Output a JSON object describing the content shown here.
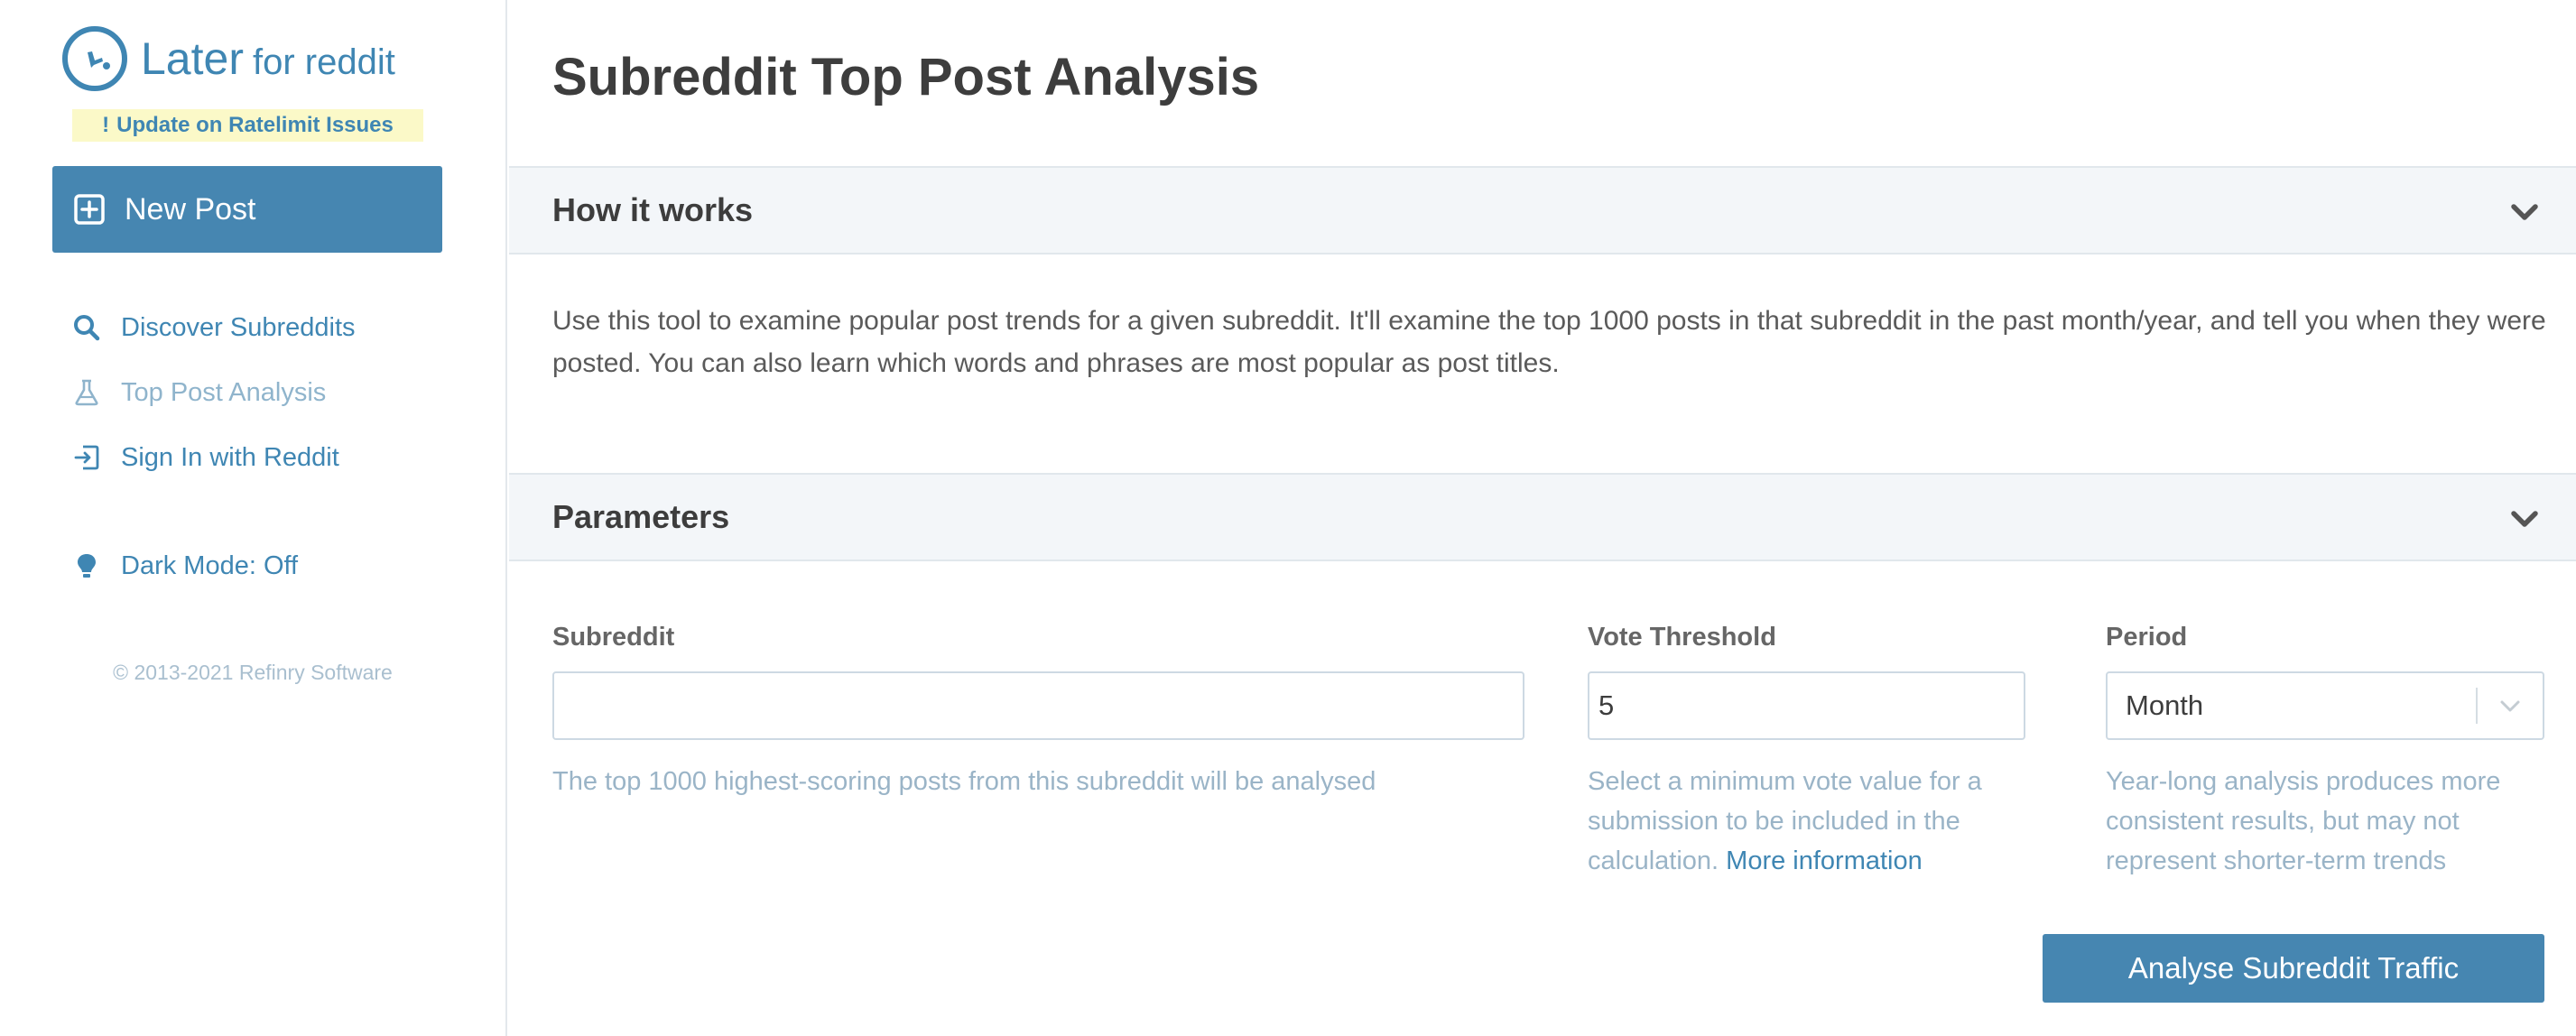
{
  "sidebar": {
    "logo": {
      "main": "Later",
      "sub": "for reddit"
    },
    "notice": "Update on Ratelimit Issues",
    "new_post": "New Post",
    "nav": [
      {
        "label": "Discover Subreddits",
        "icon": "search-icon"
      },
      {
        "label": "Top Post Analysis",
        "icon": "flask-icon",
        "active": true
      },
      {
        "label": "Sign In with Reddit",
        "icon": "sign-in-icon"
      }
    ],
    "dark_mode": "Dark Mode: Off",
    "copyright": "© 2013-2021 Refinry Software"
  },
  "main": {
    "title": "Subreddit Top Post Analysis",
    "how_it_works": {
      "heading": "How it works",
      "text": "Use this tool to examine popular post trends for a given subreddit. It'll examine the top 1000 posts in that subreddit in the past month/year, and tell you when they were posted. You can also learn which words and phrases are most popular as post titles."
    },
    "parameters": {
      "heading": "Parameters",
      "subreddit": {
        "label": "Subreddit",
        "value": "",
        "help": "The top 1000 highest-scoring posts from this subreddit will be analysed"
      },
      "vote_threshold": {
        "label": "Vote Threshold",
        "value": "5",
        "help": "Select a minimum vote value for a submission to be included in the calculation.",
        "help_link": "More information"
      },
      "period": {
        "label": "Period",
        "value": "Month",
        "help": "Year-long analysis produces more consistent results, but may not represent shorter-term trends"
      },
      "submit": "Analyse Subreddit Traffic"
    }
  },
  "colors": {
    "accent": "#4686b1",
    "link": "#3f86b3",
    "notice_bg": "#fbf9c8",
    "muted": "#9ab4c7"
  }
}
